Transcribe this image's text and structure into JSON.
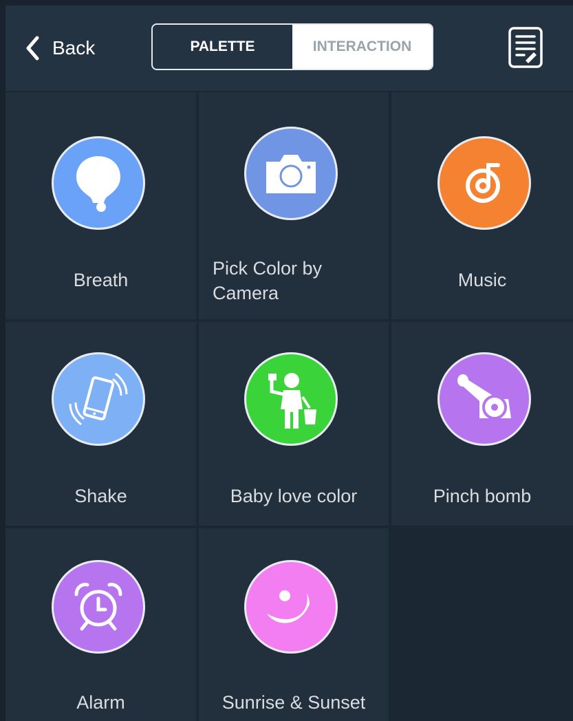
{
  "header": {
    "back_label": "Back",
    "tabs": [
      {
        "label": "PALETTE",
        "active": true
      },
      {
        "label": "INTERACTION",
        "active": false
      }
    ]
  },
  "modes": [
    {
      "label": "Breath",
      "icon": "bubble-icon",
      "color": "#6aa2f7"
    },
    {
      "label": "Pick Color by",
      "label_line2": "Camera",
      "icon": "camera-icon",
      "color": "#6f95e4"
    },
    {
      "label": "Music",
      "icon": "music-note-icon",
      "color": "#f58230"
    },
    {
      "label": "Shake",
      "icon": "phone-shake-icon",
      "color": "#7db0f5"
    },
    {
      "label": "Baby love color",
      "icon": "painter-icon",
      "color": "#3ad43a"
    },
    {
      "label": "Pinch bomb",
      "icon": "cannon-icon",
      "color": "#b675ee"
    },
    {
      "label": "Alarm",
      "icon": "alarm-clock-icon",
      "color": "#b675ee"
    },
    {
      "label": "Sunrise & Sunset",
      "icon": "sun-moon-icon",
      "color": "#f27ef2"
    }
  ]
}
